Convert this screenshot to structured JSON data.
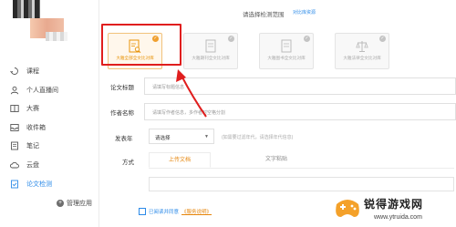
{
  "sidebar": {
    "items": [
      {
        "label": "课程",
        "icon": "recycle-icon",
        "active": false
      },
      {
        "label": "个人直播间",
        "icon": "user-icon",
        "active": false
      },
      {
        "label": "大赛",
        "icon": "book-icon",
        "active": false
      },
      {
        "label": "收件箱",
        "icon": "inbox-icon",
        "active": false
      },
      {
        "label": "笔记",
        "icon": "note-icon",
        "active": false
      },
      {
        "label": "云盘",
        "icon": "cloud-icon",
        "active": false
      },
      {
        "label": "论文检测",
        "icon": "document-check-icon",
        "active": true
      }
    ],
    "manage_label": "管理应用",
    "accent": "#2b8ae8"
  },
  "scope": {
    "title": "请选择检测范围",
    "link": "对比库资源"
  },
  "cards": [
    {
      "label": "大雅全部全文比对库",
      "icon": "document-search-icon",
      "selected": true
    },
    {
      "label": "大雅期刊全文比对库",
      "icon": "document-icon",
      "selected": false
    },
    {
      "label": "大雅图书全文比对库",
      "icon": "document-icon",
      "selected": false
    },
    {
      "label": "大雅法律全文比对库",
      "icon": "scales-icon",
      "selected": false
    }
  ],
  "form": {
    "title_label": "论文标题",
    "title_placeholder": "请填写标题信息",
    "author_label": "作者名称",
    "author_placeholder": "请填写作者信息，多作者时空格分割",
    "year_label": "发表年",
    "year_value": "请选择",
    "year_hint": "(如需要过滤年代，请选择年代信息)",
    "method_label": "方式"
  },
  "tabs": [
    {
      "label": "上传文档",
      "active": true
    },
    {
      "label": "文字粘贴",
      "active": false
    }
  ],
  "agreement": {
    "text": "已阅读并同意",
    "link": "《服务说明》"
  },
  "watermark": {
    "title": "锐得游戏网",
    "url": "www.ytruida.com"
  },
  "colors": {
    "highlight": "#e01e1e",
    "selected": "#f0a030",
    "link": "#2b8ae8"
  }
}
